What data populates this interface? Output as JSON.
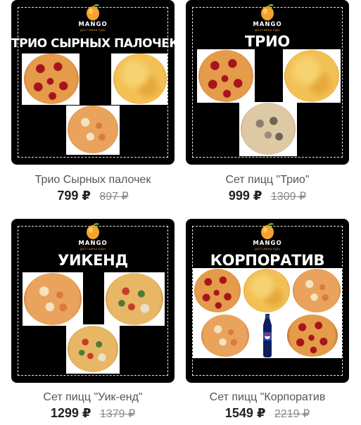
{
  "logo": {
    "name": "MANGO",
    "subtitle": "ДОСТАВКА ЕДЫ"
  },
  "products": [
    {
      "banner": "ТРИО СЫРНЫХ ПАЛОЧЕК",
      "name": "Трио Сырных палочек",
      "price": "799 ₽",
      "old_price": "897 ₽"
    },
    {
      "banner": "ТРИО",
      "name": "Сет пицц \"Трио\"",
      "price": "999 ₽",
      "old_price": "1309 ₽"
    },
    {
      "banner": "УИКЕНД",
      "name": "Сет пицц \"Уик-енд\"",
      "price": "1299 ₽",
      "old_price": "1379 ₽"
    },
    {
      "banner": "КОРПОРАТИВ",
      "name": "Сет пицц \"Корпоратив",
      "price": "1549 ₽",
      "old_price": "2219 ₽"
    }
  ],
  "colors": {
    "card_bg": "#000000",
    "accent": "#f0a33a",
    "old_price": "#888888"
  },
  "icons": [
    "mango-logo-icon",
    "pizza-photo",
    "pepsi-bottle-photo"
  ]
}
